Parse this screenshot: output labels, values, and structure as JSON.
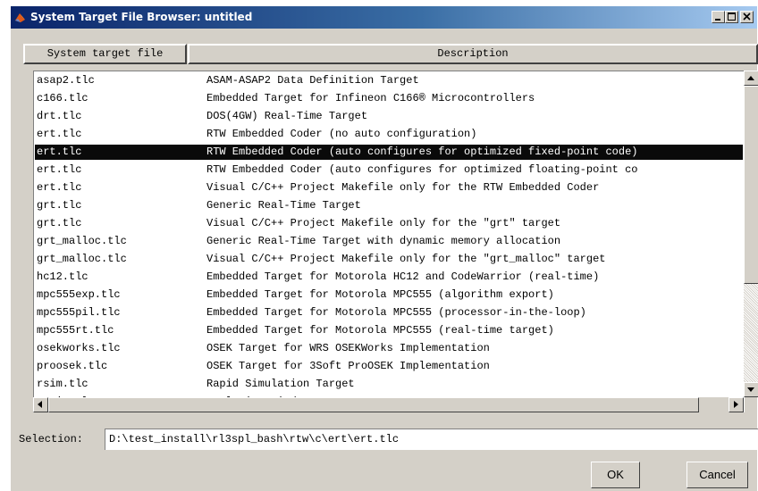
{
  "window": {
    "title": "System Target File Browser: untitled",
    "controls": {
      "minimize": "minimize",
      "maximize": "maximize",
      "close": "close"
    }
  },
  "table": {
    "columns": [
      "System target file",
      "Description"
    ],
    "selected_index": 4,
    "rows": [
      {
        "file": "asap2.tlc",
        "description": "ASAM-ASAP2 Data Definition Target"
      },
      {
        "file": "c166.tlc",
        "description": "Embedded Target for Infineon C166® Microcontrollers"
      },
      {
        "file": "drt.tlc",
        "description": "DOS(4GW) Real-Time Target"
      },
      {
        "file": "ert.tlc",
        "description": "RTW Embedded Coder (no auto configuration)"
      },
      {
        "file": "ert.tlc",
        "description": "RTW Embedded Coder (auto configures for optimized fixed-point code)"
      },
      {
        "file": "ert.tlc",
        "description": "RTW Embedded Coder (auto configures for optimized floating-point co"
      },
      {
        "file": "ert.tlc",
        "description": "Visual C/C++ Project Makefile only for the RTW Embedded Coder"
      },
      {
        "file": "grt.tlc",
        "description": "Generic Real-Time Target"
      },
      {
        "file": "grt.tlc",
        "description": "Visual C/C++ Project Makefile only for the \"grt\" target"
      },
      {
        "file": "grt_malloc.tlc",
        "description": "Generic Real-Time Target with dynamic memory allocation"
      },
      {
        "file": "grt_malloc.tlc",
        "description": "Visual C/C++ Project Makefile only for the \"grt_malloc\" target"
      },
      {
        "file": "hc12.tlc",
        "description": "Embedded Target for Motorola HC12 and CodeWarrior (real-time)"
      },
      {
        "file": "mpc555exp.tlc",
        "description": "Embedded Target for Motorola MPC555 (algorithm export)"
      },
      {
        "file": "mpc555pil.tlc",
        "description": "Embedded Target for Motorola MPC555 (processor-in-the-loop)"
      },
      {
        "file": "mpc555rt.tlc",
        "description": "Embedded Target for Motorola MPC555 (real-time target)"
      },
      {
        "file": "osekworks.tlc",
        "description": "OSEK Target for WRS OSEKWorks Implementation"
      },
      {
        "file": "proosek.tlc",
        "description": "OSEK Target for 3Soft ProOSEK Implementation"
      },
      {
        "file": "rsim.tlc",
        "description": "Rapid Simulation Target"
      },
      {
        "file": "rtwin.tlc",
        "description": "Real-Time Windows Target"
      }
    ]
  },
  "selection": {
    "label": "Selection:",
    "value": "D:\\test_install\\rl3spl_bash\\rtw\\c\\ert\\ert.tlc"
  },
  "buttons": {
    "ok": "OK",
    "cancel": "Cancel"
  },
  "colors": {
    "titlebar_start": "#0a246a",
    "titlebar_end": "#a6caf0",
    "face": "#d4d0c8",
    "selected_row": "#0a0a0a"
  }
}
